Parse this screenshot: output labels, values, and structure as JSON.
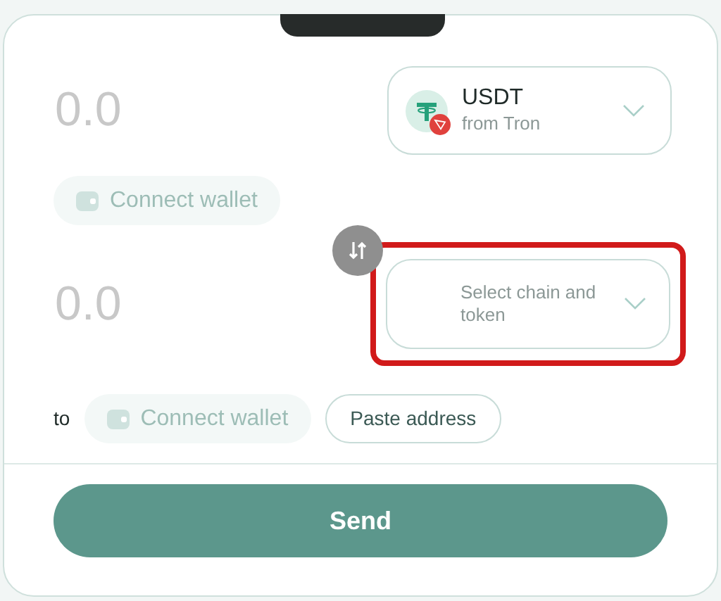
{
  "source": {
    "amount_placeholder": "0.0",
    "token": {
      "symbol": "USDT",
      "chain": "from Tron"
    },
    "wallet_button": {
      "label": "Connect wallet",
      "disabled": true
    }
  },
  "destination": {
    "amount_placeholder": "0.0",
    "token_selector": {
      "label": "Select chain and token",
      "highlighted": true
    }
  },
  "recipient": {
    "prefix": "to",
    "wallet_button": {
      "label": "Connect wallet",
      "disabled": true
    },
    "paste_button": "Paste address"
  },
  "send_button": "Send"
}
